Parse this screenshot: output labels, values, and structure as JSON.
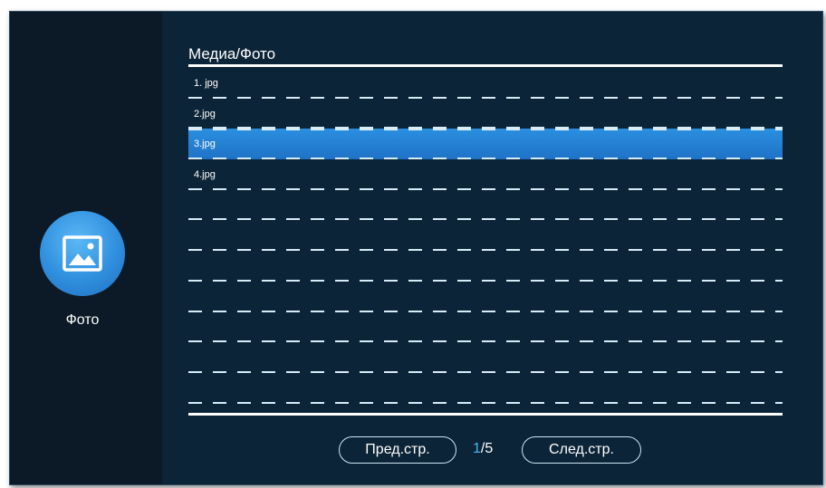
{
  "sidebar": {
    "app": {
      "label": "Фото",
      "icon": "image-icon"
    }
  },
  "header": {
    "breadcrumb": "Медиа/Фото"
  },
  "files": [
    {
      "label": "1. jpg",
      "selected": false
    },
    {
      "label": "2.jpg",
      "selected": false
    },
    {
      "label": "3.jpg",
      "selected": true
    },
    {
      "label": "4.jpg",
      "selected": false
    },
    {
      "label": "",
      "selected": false
    },
    {
      "label": "",
      "selected": false
    },
    {
      "label": "",
      "selected": false
    },
    {
      "label": "",
      "selected": false
    },
    {
      "label": "",
      "selected": false
    },
    {
      "label": "",
      "selected": false
    },
    {
      "label": "",
      "selected": false
    }
  ],
  "pager": {
    "prev_label": "Пред.стр.",
    "next_label": "След.стр.",
    "current": "1",
    "total": "/5"
  },
  "colors": {
    "background": "#0c2437",
    "sidebar": "#0b1a26",
    "accent": "#2b8fe0",
    "page_current": "#4db4f2"
  }
}
